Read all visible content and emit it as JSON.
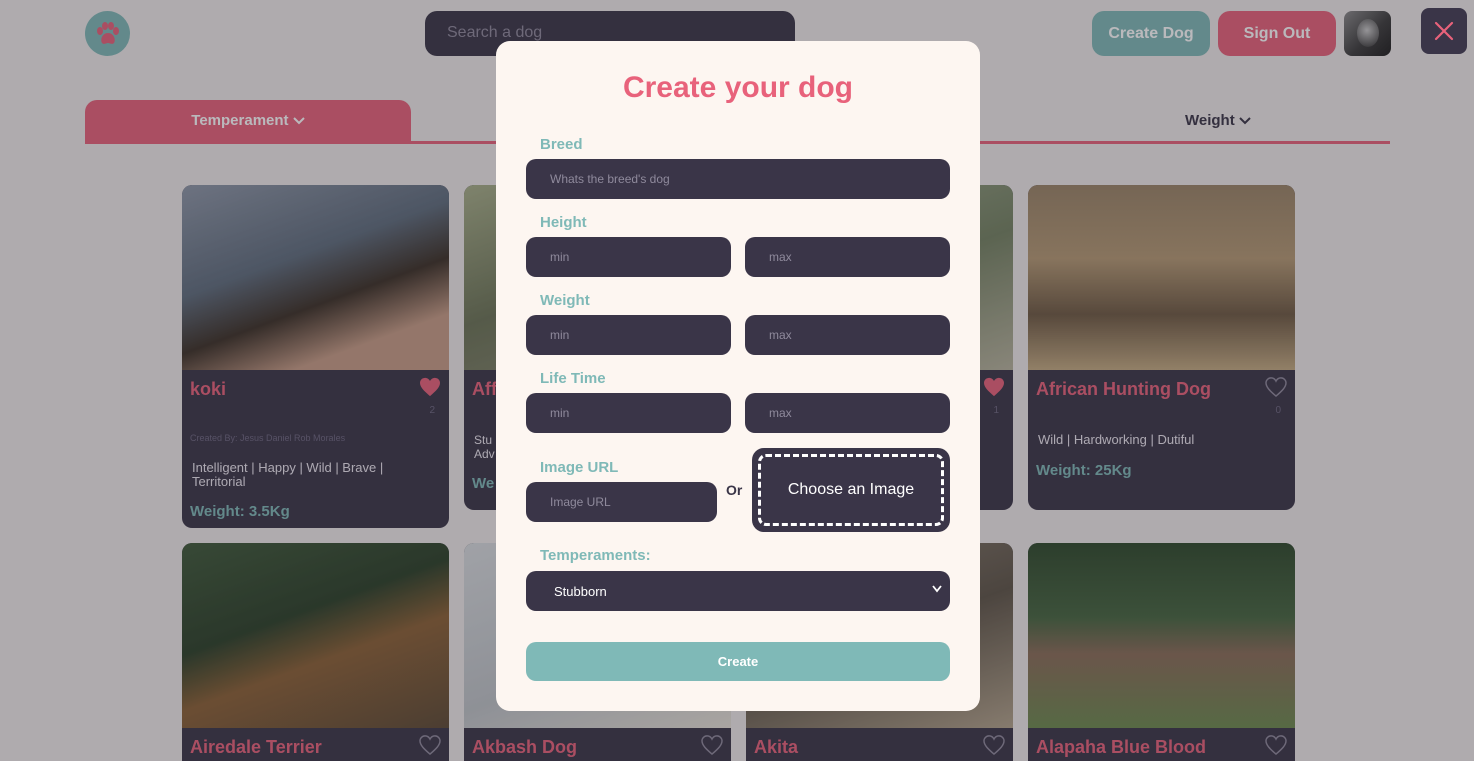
{
  "header": {
    "search_placeholder": "Search a dog",
    "create_dog_label": "Create Dog",
    "sign_out_label": "Sign Out"
  },
  "filters": {
    "temperament_label": "Temperament",
    "weight_label": "Weight"
  },
  "cards": [
    {
      "name": "koki",
      "likes": "2",
      "creator": "Created By: Jesus Daniel Rob Morales",
      "temperaments": "Intelligent | Happy | Wild | Brave | Territorial",
      "weight": "Weight: 3.5Kg"
    },
    {
      "name": "Aff",
      "temperaments": "Stu Adv",
      "weight": "We"
    },
    {
      "name": "",
      "likes": "1"
    },
    {
      "name": "African Hunting Dog",
      "likes": "0",
      "temperaments": "Wild | Hardworking | Dutiful",
      "weight": "Weight: 25Kg"
    },
    {
      "name": "Airedale Terrier"
    },
    {
      "name": "Akbash Dog"
    },
    {
      "name": "Akita"
    },
    {
      "name": "Alapaha Blue Blood"
    }
  ],
  "modal": {
    "title": "Create your dog",
    "breed_label": "Breed",
    "breed_placeholder": "Whats the breed's dog",
    "height_label": "Height",
    "weight_label": "Weight",
    "lifetime_label": "Life Time",
    "min_placeholder": "min",
    "max_placeholder": "max",
    "image_url_label": "Image URL",
    "image_url_placeholder": "Image URL",
    "or_label": "Or",
    "choose_image_label": "Choose an Image",
    "temperaments_label": "Temperaments:",
    "temperament_selected": "Stubborn",
    "create_label": "Create"
  },
  "colors": {
    "accent_pink": "#e8627b",
    "accent_teal": "#7fb9b7",
    "dark": "#3a3548",
    "modal_bg": "#fdf6f1"
  }
}
